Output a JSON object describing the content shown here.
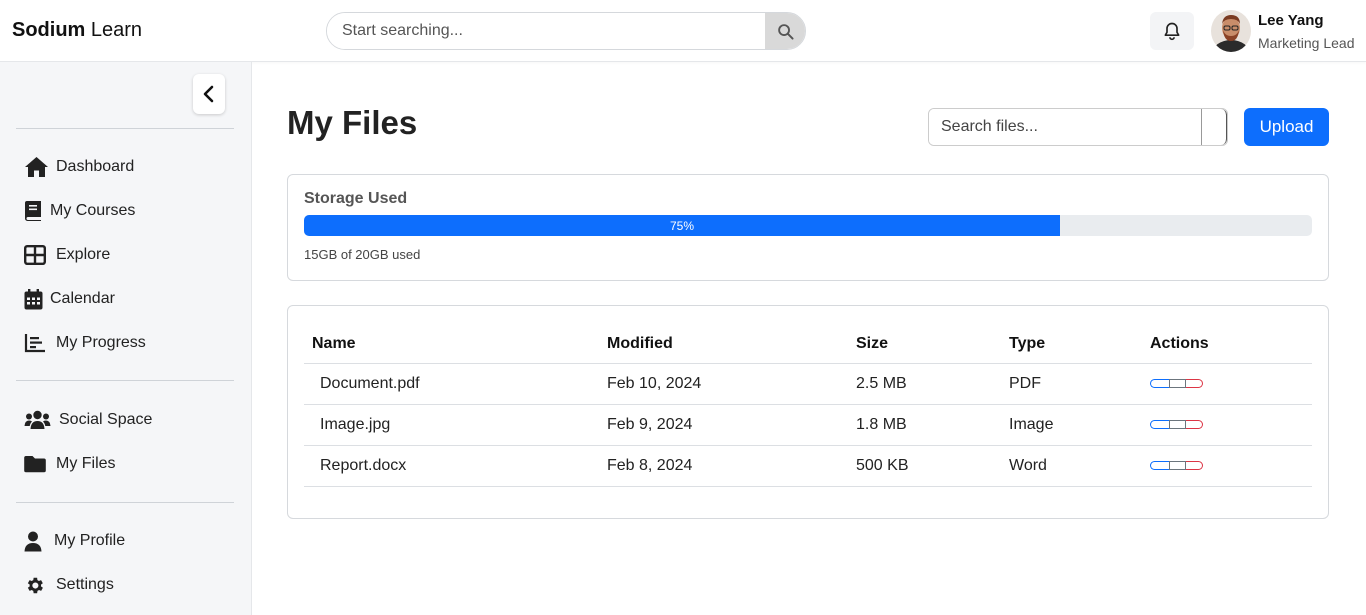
{
  "header": {
    "brand_bold": "Sodium",
    "brand_light": " Learn",
    "search_placeholder": "Start searching...",
    "user_name": "Lee Yang",
    "user_role": "Marketing Lead"
  },
  "sidebar": {
    "items": [
      {
        "label": "Dashboard",
        "icon": "home-icon"
      },
      {
        "label": "My Courses",
        "icon": "book-icon"
      },
      {
        "label": "Explore",
        "icon": "grid-icon"
      },
      {
        "label": "Calendar",
        "icon": "calendar-icon"
      },
      {
        "label": "My Progress",
        "icon": "chart-icon"
      },
      {
        "label": "Social Space",
        "icon": "users-icon"
      },
      {
        "label": "My Files",
        "icon": "folder-icon"
      },
      {
        "label": "My Profile",
        "icon": "user-icon"
      },
      {
        "label": "Settings",
        "icon": "gear-icon"
      }
    ]
  },
  "main": {
    "title": "My Files",
    "file_search_placeholder": "Search files...",
    "upload_label": "Upload",
    "storage": {
      "title": "Storage Used",
      "percent": 75,
      "percent_label": "75%",
      "used_text": "15GB of 20GB used"
    },
    "table": {
      "headers": [
        "Name",
        "Modified",
        "Size",
        "Type",
        "Actions"
      ],
      "rows": [
        [
          "Document.pdf",
          "Feb 10, 2024",
          "2.5 MB",
          "PDF"
        ],
        [
          "Image.jpg",
          "Feb 9, 2024",
          "1.8 MB",
          "Image"
        ],
        [
          "Report.docx",
          "Feb 8, 2024",
          "500 KB",
          "Word"
        ]
      ]
    }
  },
  "colors": {
    "primary": "#0d6efd",
    "danger": "#dc3545",
    "secondary": "#6c757d",
    "sidebar_bg": "#f5f6f8"
  }
}
